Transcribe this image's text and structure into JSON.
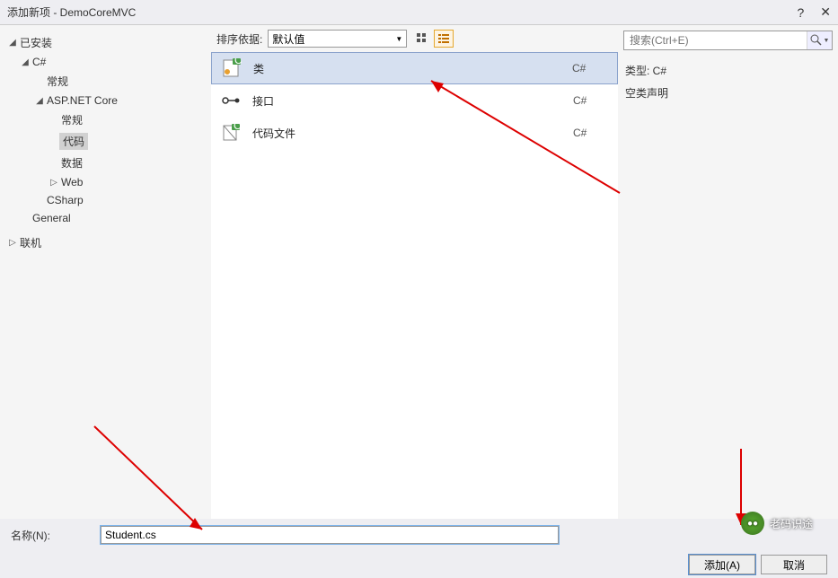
{
  "titlebar": {
    "title": "添加新项 - DemoCoreMVC",
    "help": "?",
    "close": "✕"
  },
  "sidebar": {
    "installed": "已安装",
    "csharp": "C#",
    "general_cn": "常规",
    "aspnet": "ASP.NET Core",
    "aspnet_general": "常规",
    "aspnet_code": "代码",
    "aspnet_data": "数据",
    "aspnet_web": "Web",
    "csharp_node": "CSharp",
    "general_en": "General",
    "online": "联机"
  },
  "toolbar": {
    "sort_label": "排序依据:",
    "sort_value": "默认值"
  },
  "templates": [
    {
      "name": "类",
      "lang": "C#"
    },
    {
      "name": "接口",
      "lang": "C#"
    },
    {
      "name": "代码文件",
      "lang": "C#"
    }
  ],
  "rightpanel": {
    "search_placeholder": "搜索(Ctrl+E)",
    "type_line": "类型:  C#",
    "desc_line": "空类声明"
  },
  "bottom": {
    "name_label": "名称(N):",
    "name_value": "Student.cs",
    "add_btn": "添加(A)",
    "cancel_btn": "取消"
  },
  "watermark": {
    "text": "老码识途"
  }
}
